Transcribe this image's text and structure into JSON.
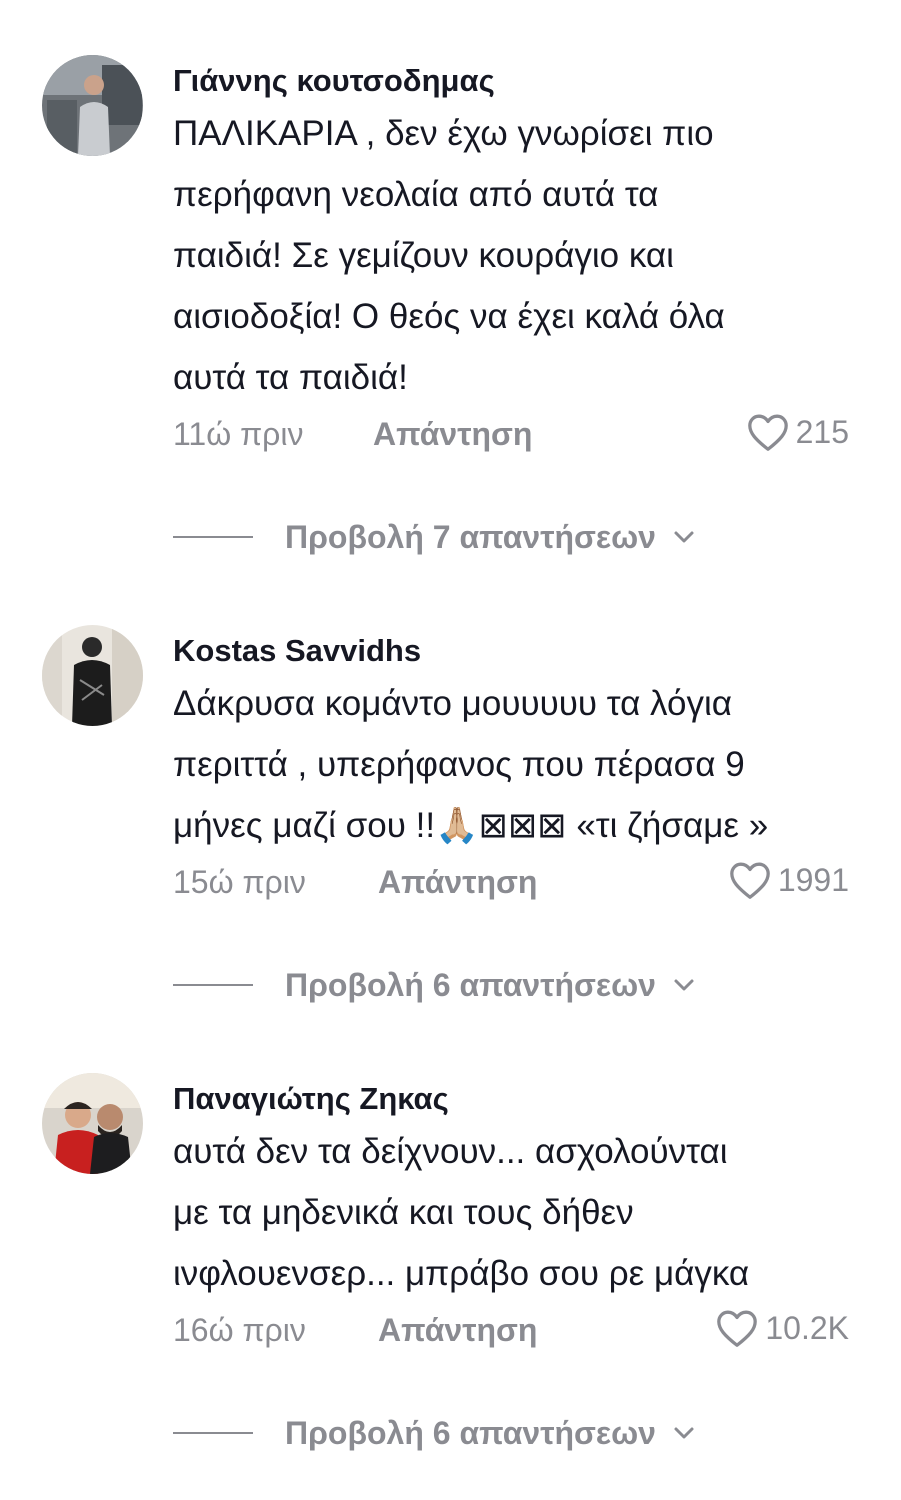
{
  "comments": [
    {
      "username": "Γιάννης κουτσοδημας",
      "text": "ΠΑΛΙΚΑΡΙΑ , δεν έχω γνωρίσει πιο\nπερήφανη νεολαία από αυτά τα\nπαιδιά! Σε γεμίζουν κουράγιο και\nαισιοδοξία! Ο θεός να έχει καλά όλα\nαυτά τα παιδιά!",
      "time": "11ώ πριν",
      "reply_label": "Απάντηση",
      "likes": "215",
      "view_replies": "Προβολή 7 απαντήσεων"
    },
    {
      "username": "Kostas Savvidhs",
      "text": "Δάκρυσα κομάντο μουυυυυ τα λόγια\nπεριττά , υπερήφανος που πέρασα 9\nμήνες μαζί σου !!🙏🏼⊠⊠⊠ «τι ζήσαμε »",
      "time": "15ώ πριν",
      "reply_label": "Απάντηση",
      "likes": "1991",
      "view_replies": "Προβολή 6 απαντήσεων"
    },
    {
      "username": "Παναγιώτης Ζηκας",
      "text": "αυτά δεν τα δείχνουν... ασχολούνται\nμε τα μηδενικά και τους δήθεν\nινφλουενσερ... μπράβο σου ρε μάγκα",
      "time": "16ώ πριν",
      "reply_label": "Απάντηση",
      "likes": "10.2K",
      "view_replies": "Προβολή 6 απαντήσεων"
    }
  ],
  "icons": {
    "like": "heart-outline-icon",
    "expand": "chevron-down-icon"
  },
  "colors": {
    "text": "#161823",
    "muted": "#8a8b91",
    "background": "#ffffff"
  }
}
